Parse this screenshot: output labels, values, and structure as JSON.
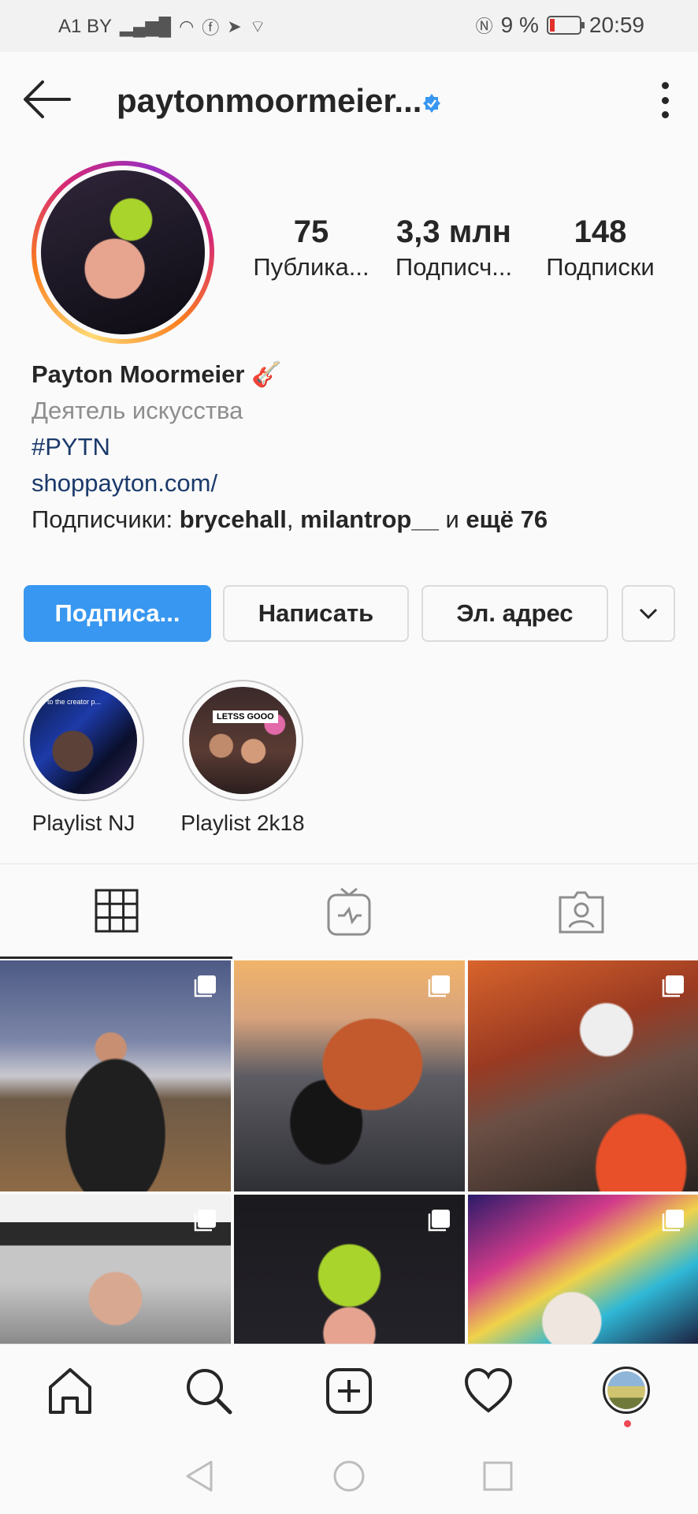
{
  "status_bar": {
    "carrier": "A1 BY",
    "battery": "9 %",
    "time": "20:59"
  },
  "header": {
    "username": "paytonmoormeier..."
  },
  "stats": [
    {
      "value": "75",
      "label": "Публика..."
    },
    {
      "value": "3,3 млн",
      "label": "Подписч..."
    },
    {
      "value": "148",
      "label": "Подписки"
    }
  ],
  "bio": {
    "name": "Payton Moormeier 🎸",
    "category": "Деятель искусства",
    "hashtag": "#PYTN",
    "link": "shoppayton.com/",
    "followers_prefix": "Подписчики: ",
    "follower1": "brycehall",
    "comma": ", ",
    "follower2": "milantrop__",
    "and": " и ",
    "more": "ещё 76"
  },
  "buttons": {
    "follow": "Подписа...",
    "message": "Написать",
    "email": "Эл. адрес"
  },
  "highlights": [
    {
      "label": "Playlist NJ",
      "sticker": "to the creator p..."
    },
    {
      "label": "Playlist 2k18",
      "sticker": "LETSS GOOO"
    }
  ],
  "tabs": [
    "grid-icon",
    "igtv-icon",
    "tagged-icon"
  ],
  "bottom_nav": [
    "home-icon",
    "search-icon",
    "add-post-icon",
    "activity-heart-icon",
    "profile-avatar"
  ],
  "colors": {
    "accent": "#3897f0",
    "link": "#1b3a6b",
    "notification_dot": "#ed4956"
  }
}
